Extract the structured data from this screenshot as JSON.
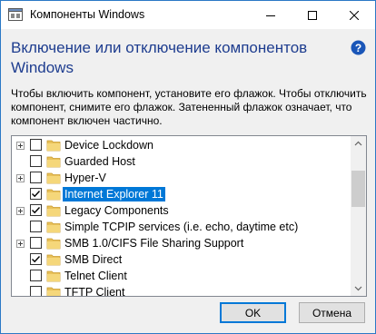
{
  "window": {
    "title": "Компоненты Windows",
    "accent_color": "#0078d7",
    "heading_color": "#1e3d8f"
  },
  "titlebar_buttons": [
    "minimize-icon",
    "maximize-icon",
    "close-icon"
  ],
  "heading": "Включение или отключение компонентов Windows",
  "help_icon": "question-mark-icon",
  "description": "Чтобы включить компонент, установите его флажок. Чтобы отключить компонент, снимите его флажок. Затененный флажок означает, что компонент включен частично.",
  "features": [
    {
      "label": "Device Lockdown",
      "expandable": true,
      "checked": "none",
      "selected": false
    },
    {
      "label": "Guarded Host",
      "expandable": false,
      "checked": "none",
      "selected": false
    },
    {
      "label": "Hyper-V",
      "expandable": true,
      "checked": "none",
      "selected": false
    },
    {
      "label": "Internet Explorer 11",
      "expandable": false,
      "checked": "full",
      "selected": true
    },
    {
      "label": "Legacy Components",
      "expandable": true,
      "checked": "full",
      "selected": false
    },
    {
      "label": "Simple TCPIP services (i.e. echo, daytime etc)",
      "expandable": false,
      "checked": "none",
      "selected": false
    },
    {
      "label": "SMB 1.0/CIFS File Sharing Support",
      "expandable": true,
      "checked": "none",
      "selected": false
    },
    {
      "label": "SMB Direct",
      "expandable": false,
      "checked": "full",
      "selected": false
    },
    {
      "label": "Telnet Client",
      "expandable": false,
      "checked": "none",
      "selected": false
    },
    {
      "label": "TFTP Client",
      "expandable": false,
      "checked": "none",
      "selected": false
    }
  ],
  "buttons": {
    "ok": "OK",
    "cancel": "Отмена"
  }
}
